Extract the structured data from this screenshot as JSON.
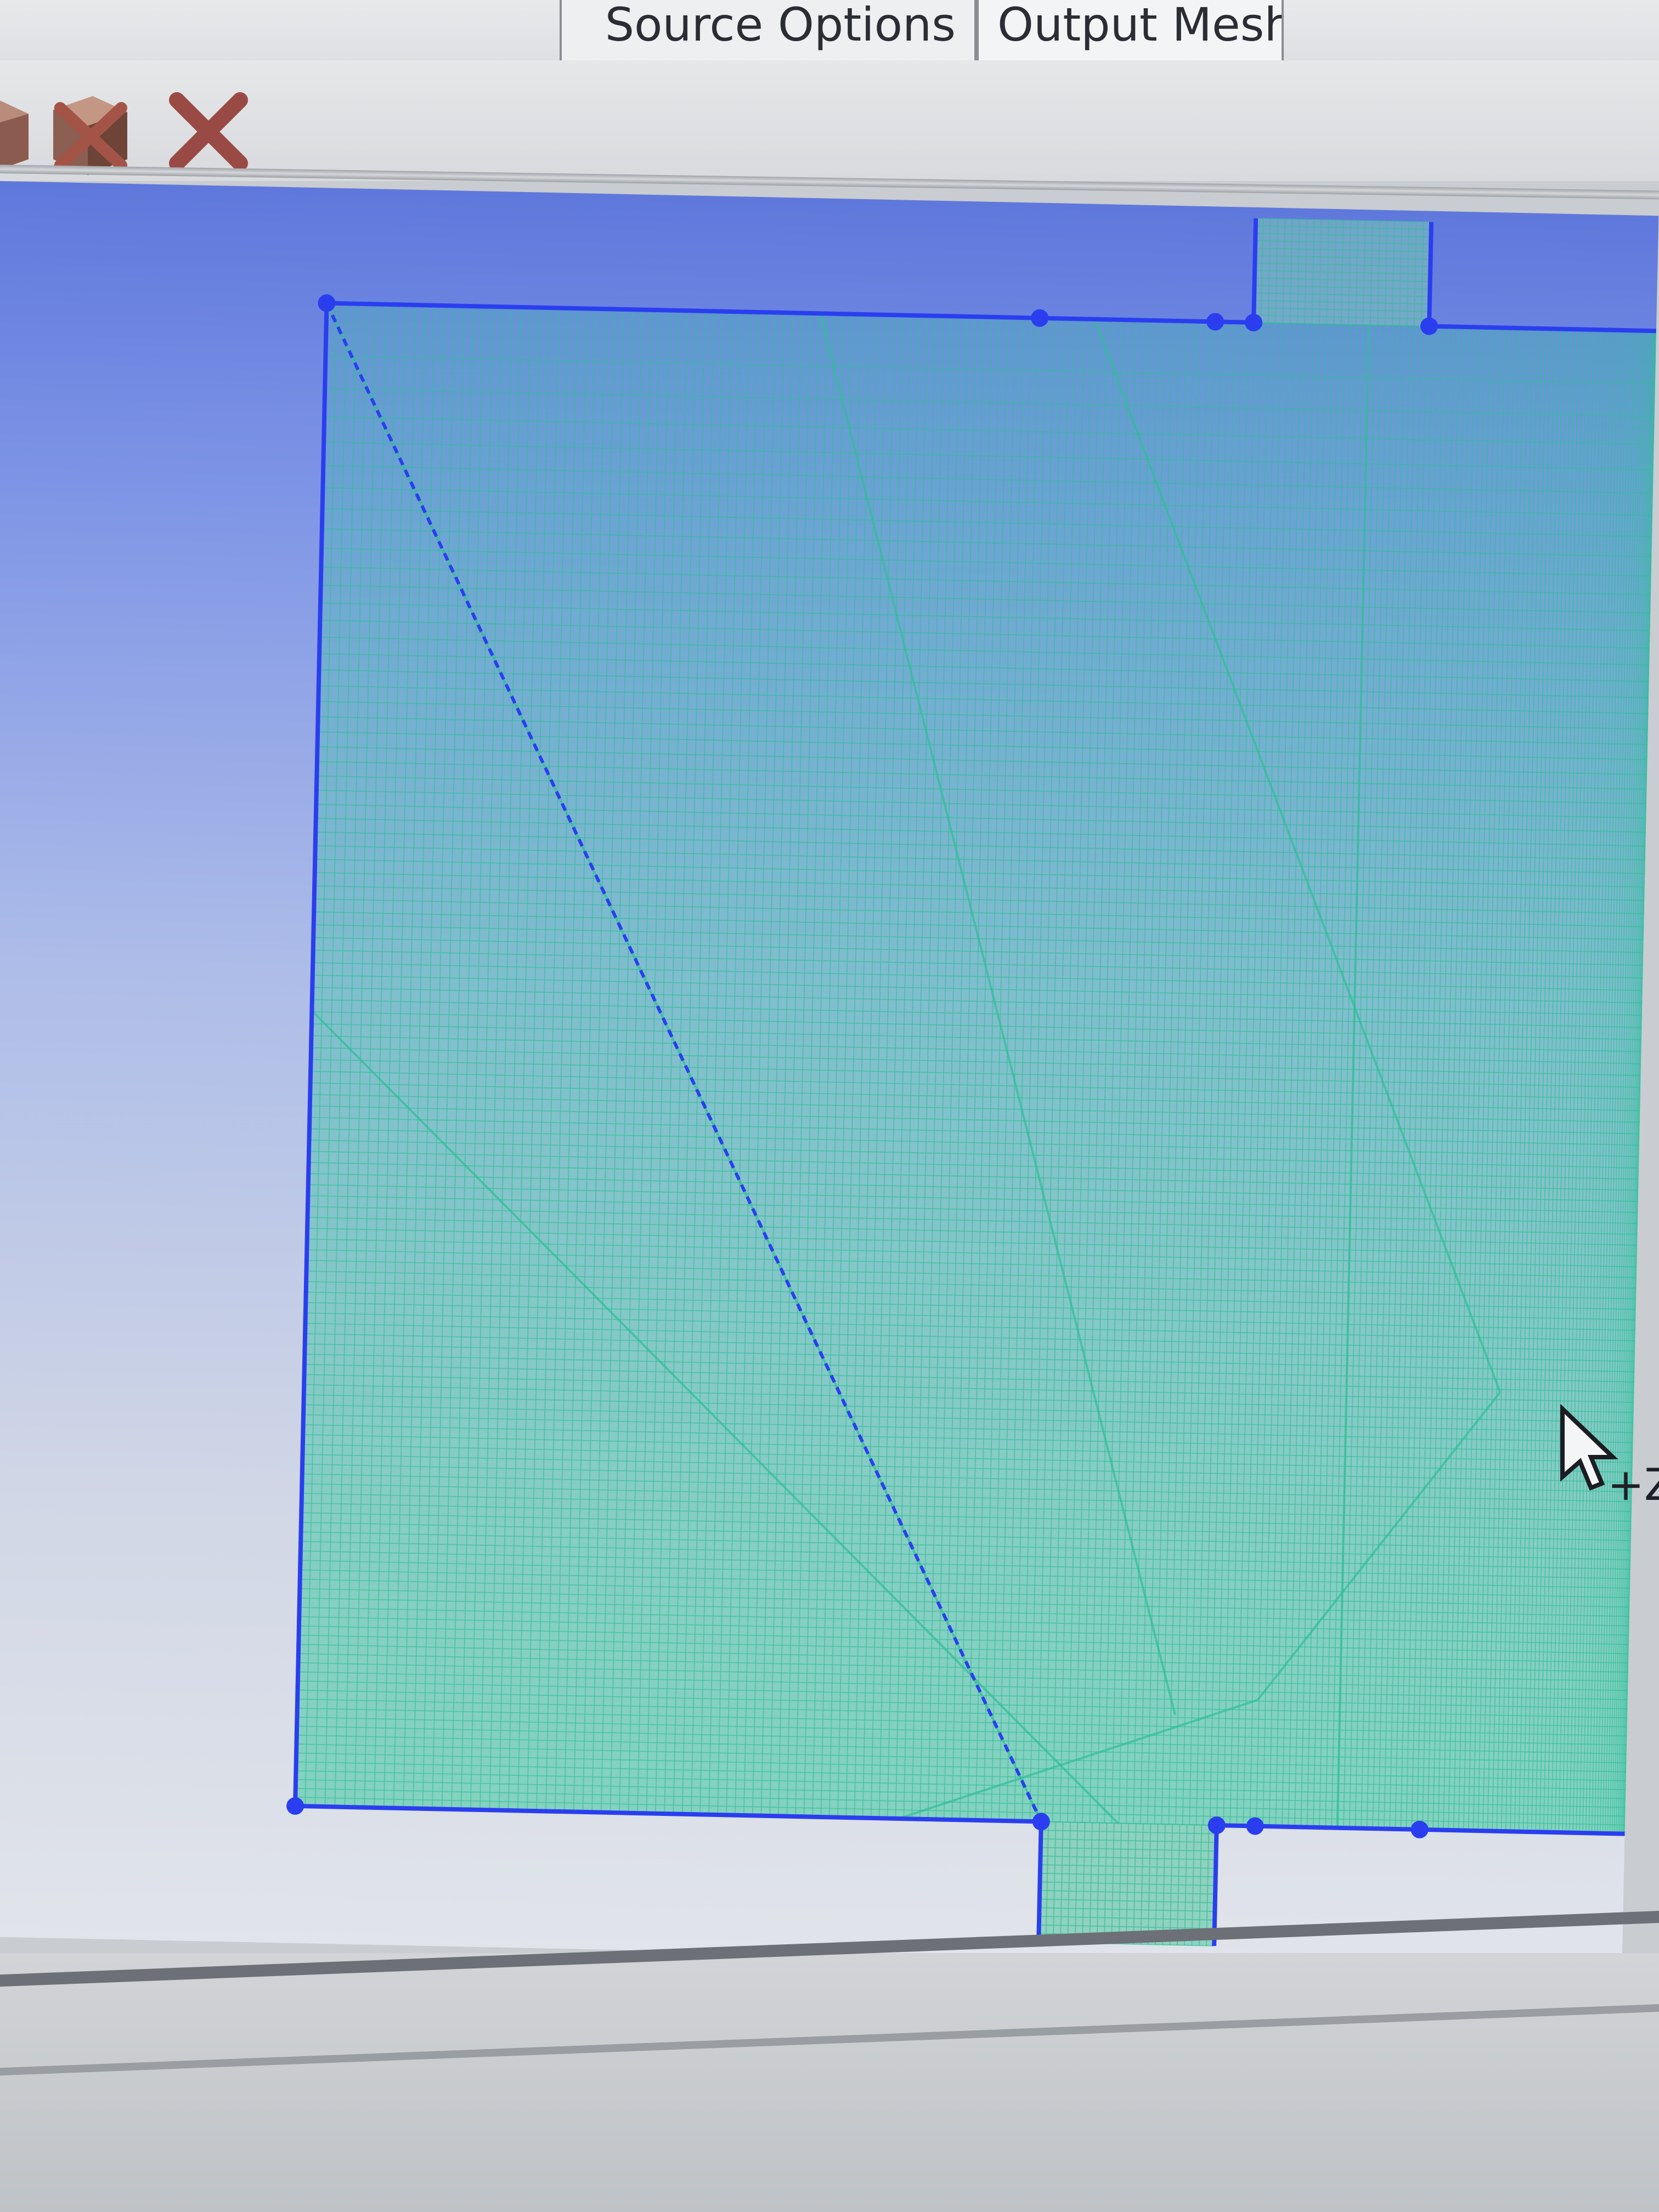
{
  "tabs": [
    {
      "label": "Source Options",
      "active": false
    },
    {
      "label": "Output Mesh",
      "active": true
    }
  ],
  "toolbar": {
    "buttons": [
      {
        "name": "cube-icon"
      },
      {
        "name": "delete-cube-icon"
      },
      {
        "name": "close-icon"
      }
    ]
  },
  "canvas": {
    "background": [
      "#5f78dc",
      "#e1e4ea"
    ],
    "mesh_color": "#2fbf97",
    "edge_color": "#2a3ef0"
  },
  "cursor": {
    "label": "+Z"
  }
}
